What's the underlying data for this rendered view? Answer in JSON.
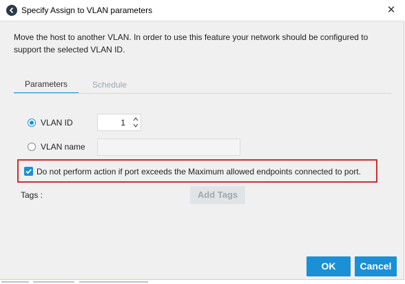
{
  "dialog": {
    "title": "Specify Assign to VLAN parameters",
    "close_symbol": "✕",
    "description": "Move the host to another VLAN. In order to use this feature your network should be configured to support the selected VLAN ID."
  },
  "tabs": [
    {
      "label": "Parameters",
      "active": true
    },
    {
      "label": "Schedule",
      "active": false
    }
  ],
  "parameters": {
    "vlan_id_label": "VLAN ID",
    "vlan_id_selected": true,
    "vlan_id_value": "1",
    "vlan_name_label": "VLAN name",
    "vlan_name_value": "",
    "checkbox_label": "Do not perform action if port exceeds the Maximum allowed endpoints connected to port.",
    "checkbox_checked": true,
    "tags_label": "Tags :",
    "add_tags_label": "Add Tags"
  },
  "footer": {
    "ok_label": "OK",
    "cancel_label": "Cancel"
  },
  "colors": {
    "accent": "#1a90d6",
    "highlight_border": "#d22b2b",
    "dialog_bg": "#f0f0f0"
  },
  "icons": {
    "app": "app-logo-icon",
    "close": "close-icon",
    "spin_up": "chevron-up-icon",
    "spin_down": "chevron-down-icon",
    "check": "checkmark-icon"
  }
}
